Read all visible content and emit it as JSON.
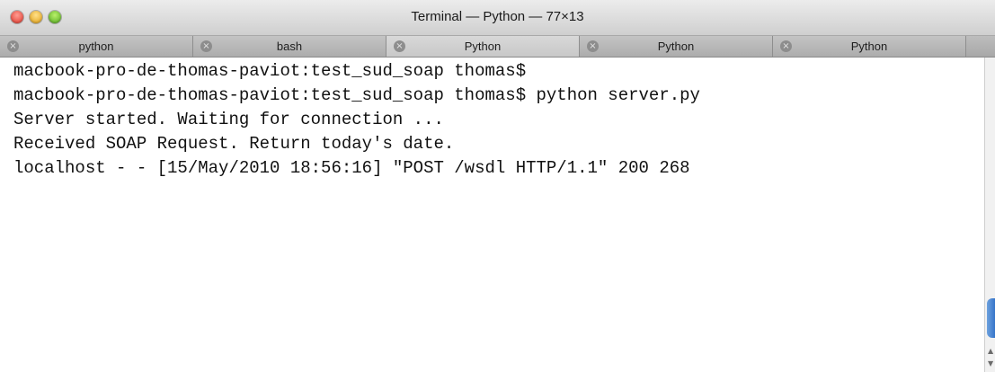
{
  "window": {
    "title": "Terminal — Python — 77×13"
  },
  "tabs": [
    {
      "label": "python"
    },
    {
      "label": "bash"
    },
    {
      "label": "Python"
    },
    {
      "label": "Python"
    },
    {
      "label": "Python"
    }
  ],
  "selected_tab_index": 2,
  "terminal": {
    "lines": [
      "macbook-pro-de-thomas-paviot:test_sud_soap thomas$",
      "macbook-pro-de-thomas-paviot:test_sud_soap thomas$ python server.py",
      "Server started. Waiting for connection ...",
      "Received SOAP Request. Return today's date.",
      "localhost - - [15/May/2010 18:56:16] \"POST /wsdl HTTP/1.1\" 200 268"
    ]
  },
  "icons": {
    "close": "close-circle-icon",
    "traffic_close": "window-close-icon",
    "traffic_minimize": "window-minimize-icon",
    "traffic_zoom": "window-zoom-icon"
  },
  "colors": {
    "close": "#e0362a",
    "minimize": "#df9d10",
    "zoom": "#4fa71d",
    "scroll_thumb": "#2f6fc7"
  }
}
